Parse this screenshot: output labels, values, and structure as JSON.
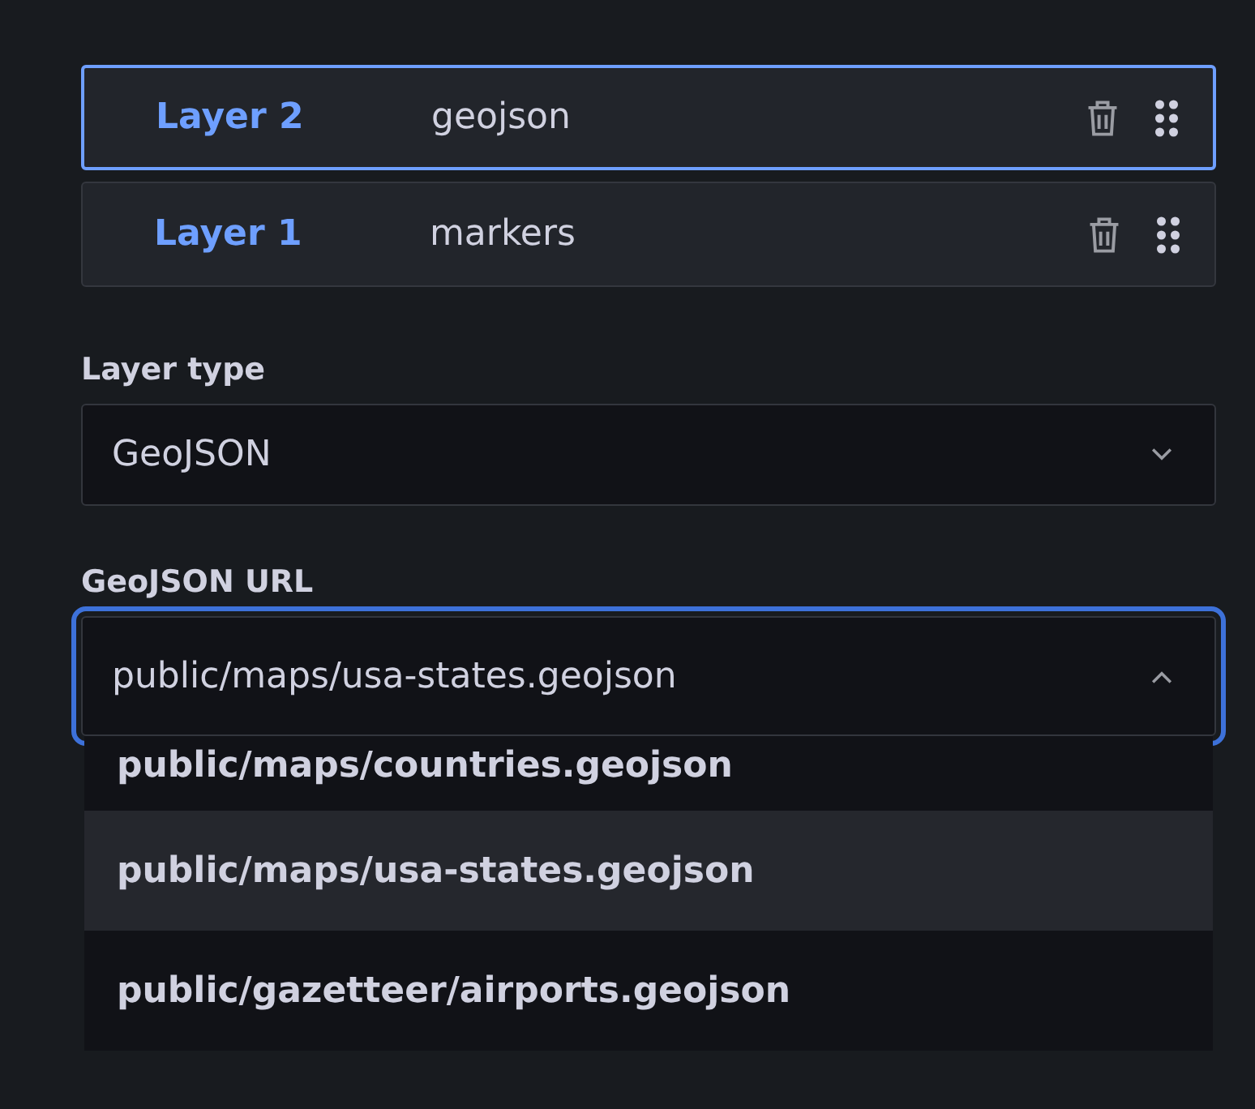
{
  "layers": [
    {
      "name": "Layer 2",
      "type": "geojson",
      "selected": true
    },
    {
      "name": "Layer 1",
      "type": "markers",
      "selected": false
    }
  ],
  "layer_type": {
    "label": "Layer type",
    "value": "GeoJSON",
    "expanded": false
  },
  "geojson_url": {
    "label": "GeoJSON URL",
    "value": "public/maps/usa-states.geojson",
    "expanded": true,
    "options": [
      {
        "label": "public/maps/countries.geojson",
        "selected": false
      },
      {
        "label": "public/maps/usa-states.geojson",
        "selected": true
      },
      {
        "label": "public/gazetteer/airports.geojson",
        "selected": false
      }
    ]
  }
}
